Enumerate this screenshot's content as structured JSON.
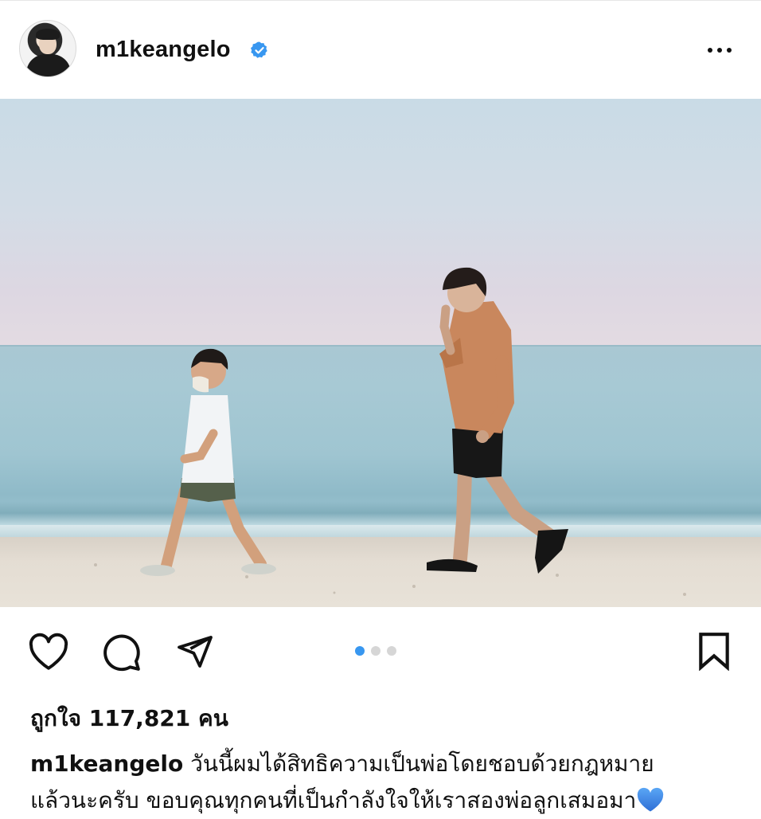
{
  "post": {
    "username": "m1keangelo",
    "verified": true,
    "likes_text": "ถูกใจ 117,821 คน",
    "caption_line1": "วันนี้ผมได้สิทธิความเป็นพ่อโดยชอบด้วยกฎหมาย",
    "caption_line2": "แล้วนะครับ ขอบคุณทุกคนที่เป็นกำลังใจให้เราสองพ่อลูกเสมอมา",
    "caption_emoji": "blue-heart",
    "carousel": {
      "total": 3,
      "active_index": 0
    }
  },
  "icons": {
    "like": "heart-outline-icon",
    "comment": "comment-bubble-icon",
    "share": "paper-plane-icon",
    "save": "bookmark-icon",
    "more": "ellipsis-icon",
    "verified": "verified-badge-icon"
  },
  "colors": {
    "verified_blue": "#3897f0",
    "carousel_active": "#3897f0",
    "heart_emoji": "#3a7fe0"
  }
}
